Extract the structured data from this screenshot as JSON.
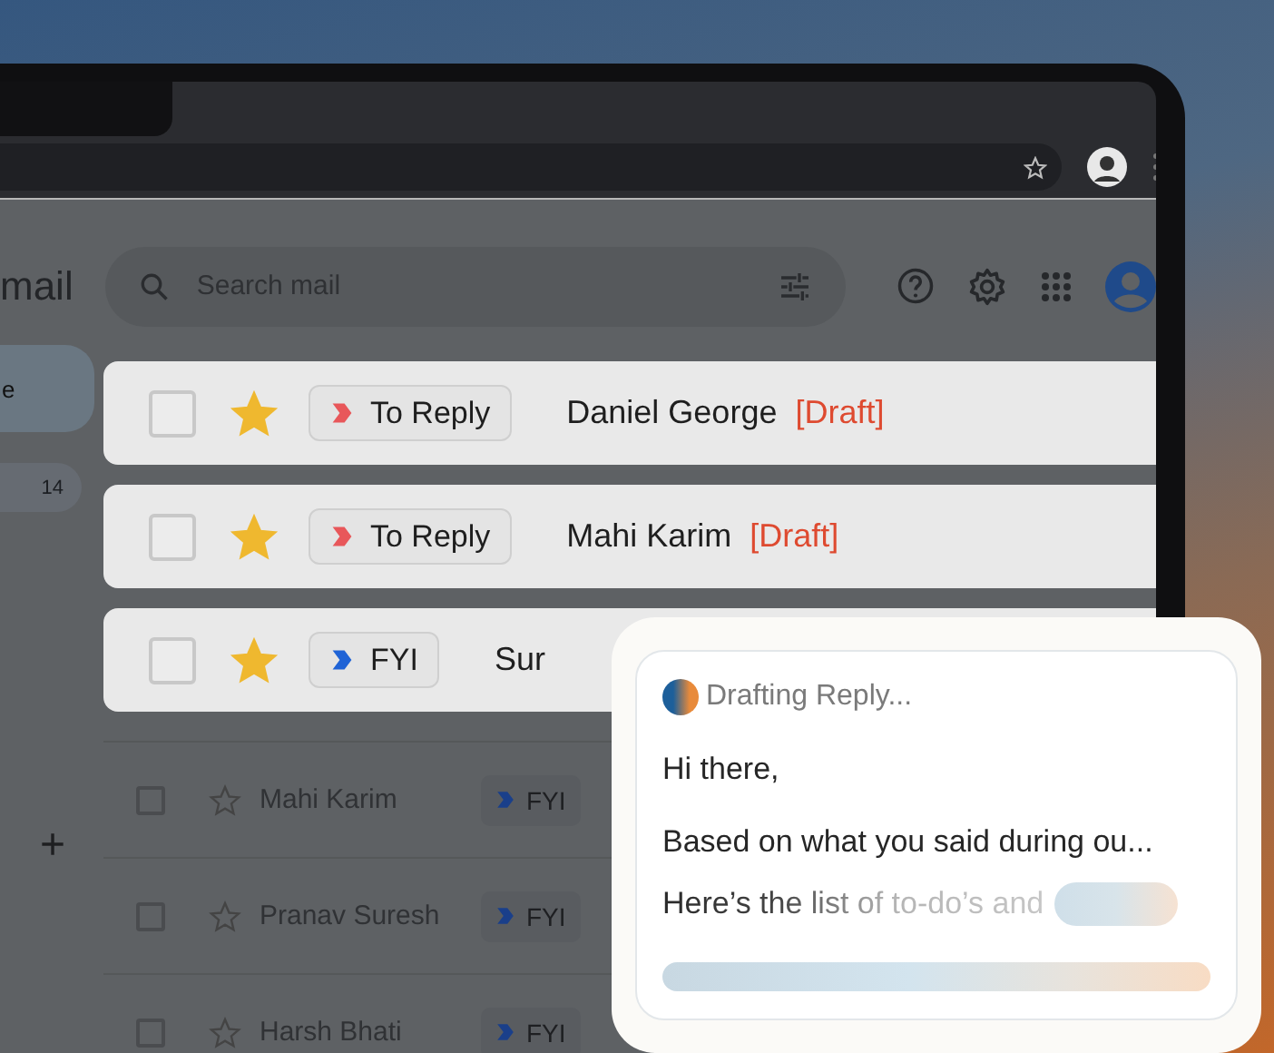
{
  "app_title": "mail",
  "search": {
    "placeholder": "Search mail"
  },
  "sidebar": {
    "items": [
      {
        "label": "e",
        "selected": true
      }
    ],
    "count": "14",
    "add_label": "+"
  },
  "highlighted_emails": [
    {
      "checked": false,
      "starred": true,
      "label": {
        "text": "To Reply",
        "color": "#e8575a"
      },
      "sender": "Daniel George",
      "draft": "[Draft]"
    },
    {
      "checked": false,
      "starred": true,
      "label": {
        "text": "To Reply",
        "color": "#e8575a"
      },
      "sender": "Mahi Karim",
      "draft": "[Draft]"
    },
    {
      "checked": false,
      "starred": true,
      "label": {
        "text": "FYI",
        "color": "#1f63d6"
      },
      "sender": "Sur"
    }
  ],
  "emails": [
    {
      "checked": false,
      "starred": false,
      "sender": "Mahi Karim",
      "label": {
        "text": "FYI",
        "color": "#1a3f8a"
      }
    },
    {
      "checked": false,
      "starred": false,
      "sender": "Pranav Suresh",
      "label": {
        "text": "FYI",
        "color": "#1a3f8a"
      }
    },
    {
      "checked": false,
      "starred": false,
      "sender": "Harsh Bhati",
      "label": {
        "text": "FYI",
        "color": "#1a3f8a"
      }
    }
  ],
  "draft_panel": {
    "status": "Drafting Reply...",
    "lines": [
      {
        "text": "Hi there,",
        "kind": "plain"
      },
      {
        "text": "Based on what you said during ou...",
        "kind": "plain"
      },
      {
        "text": "Here’s the list of to-do’s and",
        "kind": "fading"
      }
    ]
  }
}
